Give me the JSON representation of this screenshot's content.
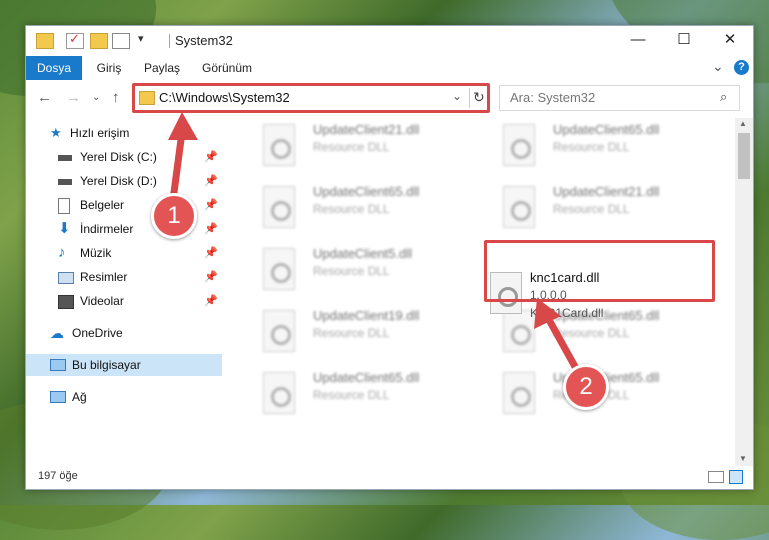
{
  "window": {
    "title": "System32",
    "minimize": "—",
    "maximize": "☐",
    "close": "✕"
  },
  "ribbon": {
    "tabs": [
      "Dosya",
      "Giriş",
      "Paylaş",
      "Görünüm"
    ],
    "expand": "⌄",
    "help": "?"
  },
  "address": {
    "path": "C:\\Windows\\System32",
    "search_placeholder": "Ara: System32"
  },
  "sidebar": {
    "quick_access": "Hızlı erişim",
    "items": [
      {
        "label": "Yerel Disk (C:)",
        "icon": "drive-icon"
      },
      {
        "label": "Yerel Disk (D:)",
        "icon": "drive-icon"
      },
      {
        "label": "Belgeler",
        "icon": "documents-icon"
      },
      {
        "label": "İndirmeler",
        "icon": "download-icon"
      },
      {
        "label": "Müzik",
        "icon": "music-icon"
      },
      {
        "label": "Resimler",
        "icon": "pictures-icon"
      },
      {
        "label": "Videolar",
        "icon": "videos-icon"
      }
    ],
    "onedrive": "OneDrive",
    "this_pc": "Bu bilgisayar",
    "network": "Ağ"
  },
  "files": [
    {
      "name": "UpdateClient21.dll",
      "desc": "Resource DLL"
    },
    {
      "name": "UpdateClient65.dll",
      "desc": "Resource DLL"
    },
    {
      "name": "UpdateClient65.dll",
      "desc": "Resource DLL"
    },
    {
      "name": "UpdateClient21.dll",
      "desc": "Resource DLL"
    },
    {
      "name": "UpdateClient5.dll",
      "desc": "Resource DLL"
    },
    {
      "name": "UpdateClient19.dll",
      "desc": "Resource DLL"
    },
    {
      "name": "UpdateClient65.dll",
      "desc": "Resource DLL"
    },
    {
      "name": "UpdateClient65.dll",
      "desc": "Resource DLL"
    },
    {
      "name": "UpdateClient65.dll",
      "desc": "Resource DLL"
    }
  ],
  "selected_file": {
    "name": "knc1card.dll",
    "version": "1.0.0.0",
    "desc": "KNC1Card.dll"
  },
  "status": {
    "count": "197 öğe"
  },
  "annotations": {
    "step1": "1",
    "step2": "2",
    "color": "#d94848"
  }
}
